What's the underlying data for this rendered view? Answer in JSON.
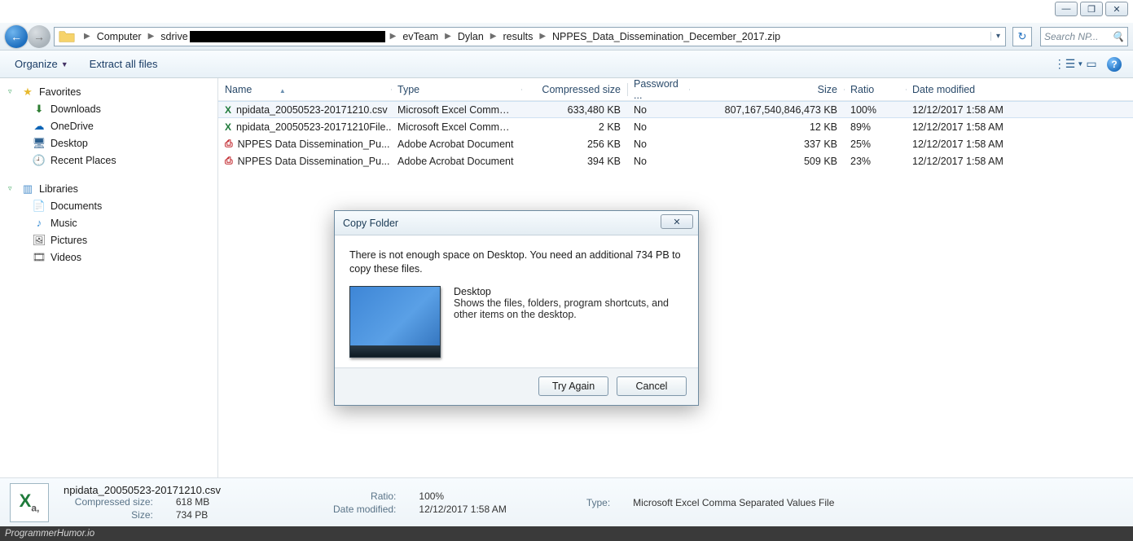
{
  "window_controls": {
    "min": "—",
    "max": "❐",
    "close": "✕"
  },
  "breadcrumb": {
    "segments": [
      "Computer",
      "sdrive",
      "evTeam",
      "Dylan",
      "results",
      "NPPES_Data_Dissemination_December_2017.zip"
    ],
    "redacted_after_index": 1
  },
  "search": {
    "placeholder": "Search NP..."
  },
  "commandbar": {
    "organize": "Organize",
    "extract": "Extract all files",
    "view_icon": "⋮☰",
    "preview_icon": "▭",
    "help_icon": "?"
  },
  "tree": {
    "favorites": {
      "label": "Favorites",
      "items": [
        {
          "icon": "download-icon",
          "glyph": "⬇",
          "label": "Downloads",
          "color": "#2e7d32"
        },
        {
          "icon": "onedrive-icon",
          "glyph": "☁",
          "label": "OneDrive",
          "color": "#0a63b5"
        },
        {
          "icon": "desktop-icon",
          "glyph": "🖥",
          "label": "Desktop",
          "color": "#2b5f8f"
        },
        {
          "icon": "recent-icon",
          "glyph": "🕘",
          "label": "Recent Places",
          "color": "#c98a2e"
        }
      ]
    },
    "libraries": {
      "label": "Libraries",
      "items": [
        {
          "icon": "documents-icon",
          "glyph": "📄",
          "label": "Documents"
        },
        {
          "icon": "music-icon",
          "glyph": "♪",
          "label": "Music",
          "color": "#3a8fd6"
        },
        {
          "icon": "pictures-icon",
          "glyph": "🖼",
          "label": "Pictures"
        },
        {
          "icon": "videos-icon",
          "glyph": "🎞",
          "label": "Videos"
        }
      ]
    }
  },
  "columns": {
    "name": "Name",
    "type": "Type",
    "compressed": "Compressed size",
    "password": "Password ...",
    "size": "Size",
    "ratio": "Ratio",
    "date": "Date modified"
  },
  "files": [
    {
      "icon": "excel-csv-icon",
      "name": "npidata_20050523-20171210.csv",
      "type": "Microsoft Excel Comma S...",
      "compressed": "633,480 KB",
      "password": "No",
      "size": "807,167,540,846,473 KB",
      "ratio": "100%",
      "date": "12/12/2017 1:58 AM",
      "selected": true
    },
    {
      "icon": "excel-csv-icon",
      "name": "npidata_20050523-20171210File...",
      "type": "Microsoft Excel Comma S...",
      "compressed": "2 KB",
      "password": "No",
      "size": "12 KB",
      "ratio": "89%",
      "date": "12/12/2017 1:58 AM"
    },
    {
      "icon": "pdf-icon",
      "name": "NPPES Data Dissemination_Pu...",
      "type": "Adobe Acrobat Document",
      "compressed": "256 KB",
      "password": "No",
      "size": "337 KB",
      "ratio": "25%",
      "date": "12/12/2017 1:58 AM"
    },
    {
      "icon": "pdf-icon",
      "name": "NPPES Data Dissemination_Pu...",
      "type": "Adobe Acrobat Document",
      "compressed": "394 KB",
      "password": "No",
      "size": "509 KB",
      "ratio": "23%",
      "date": "12/12/2017 1:58 AM"
    }
  ],
  "details": {
    "filename": "npidata_20050523-20171210.csv",
    "labels": {
      "compressed": "Compressed size:",
      "size": "Size:",
      "ratio": "Ratio:",
      "date": "Date modified:",
      "type": "Type:"
    },
    "values": {
      "compressed": "618 MB",
      "size": "734 PB",
      "ratio": "100%",
      "date": "12/12/2017 1:58 AM",
      "type": "Microsoft Excel Comma Separated Values File"
    }
  },
  "dialog": {
    "title": "Copy Folder",
    "message": "There is not enough space on Desktop. You need an additional 734 PB to copy these files.",
    "dest_name": "Desktop",
    "dest_desc": "Shows the files, folders, program shortcuts, and other items on the desktop.",
    "try_again": "Try Again",
    "cancel": "Cancel",
    "close_glyph": "✕"
  },
  "watermark": "ProgrammerHumor.io"
}
